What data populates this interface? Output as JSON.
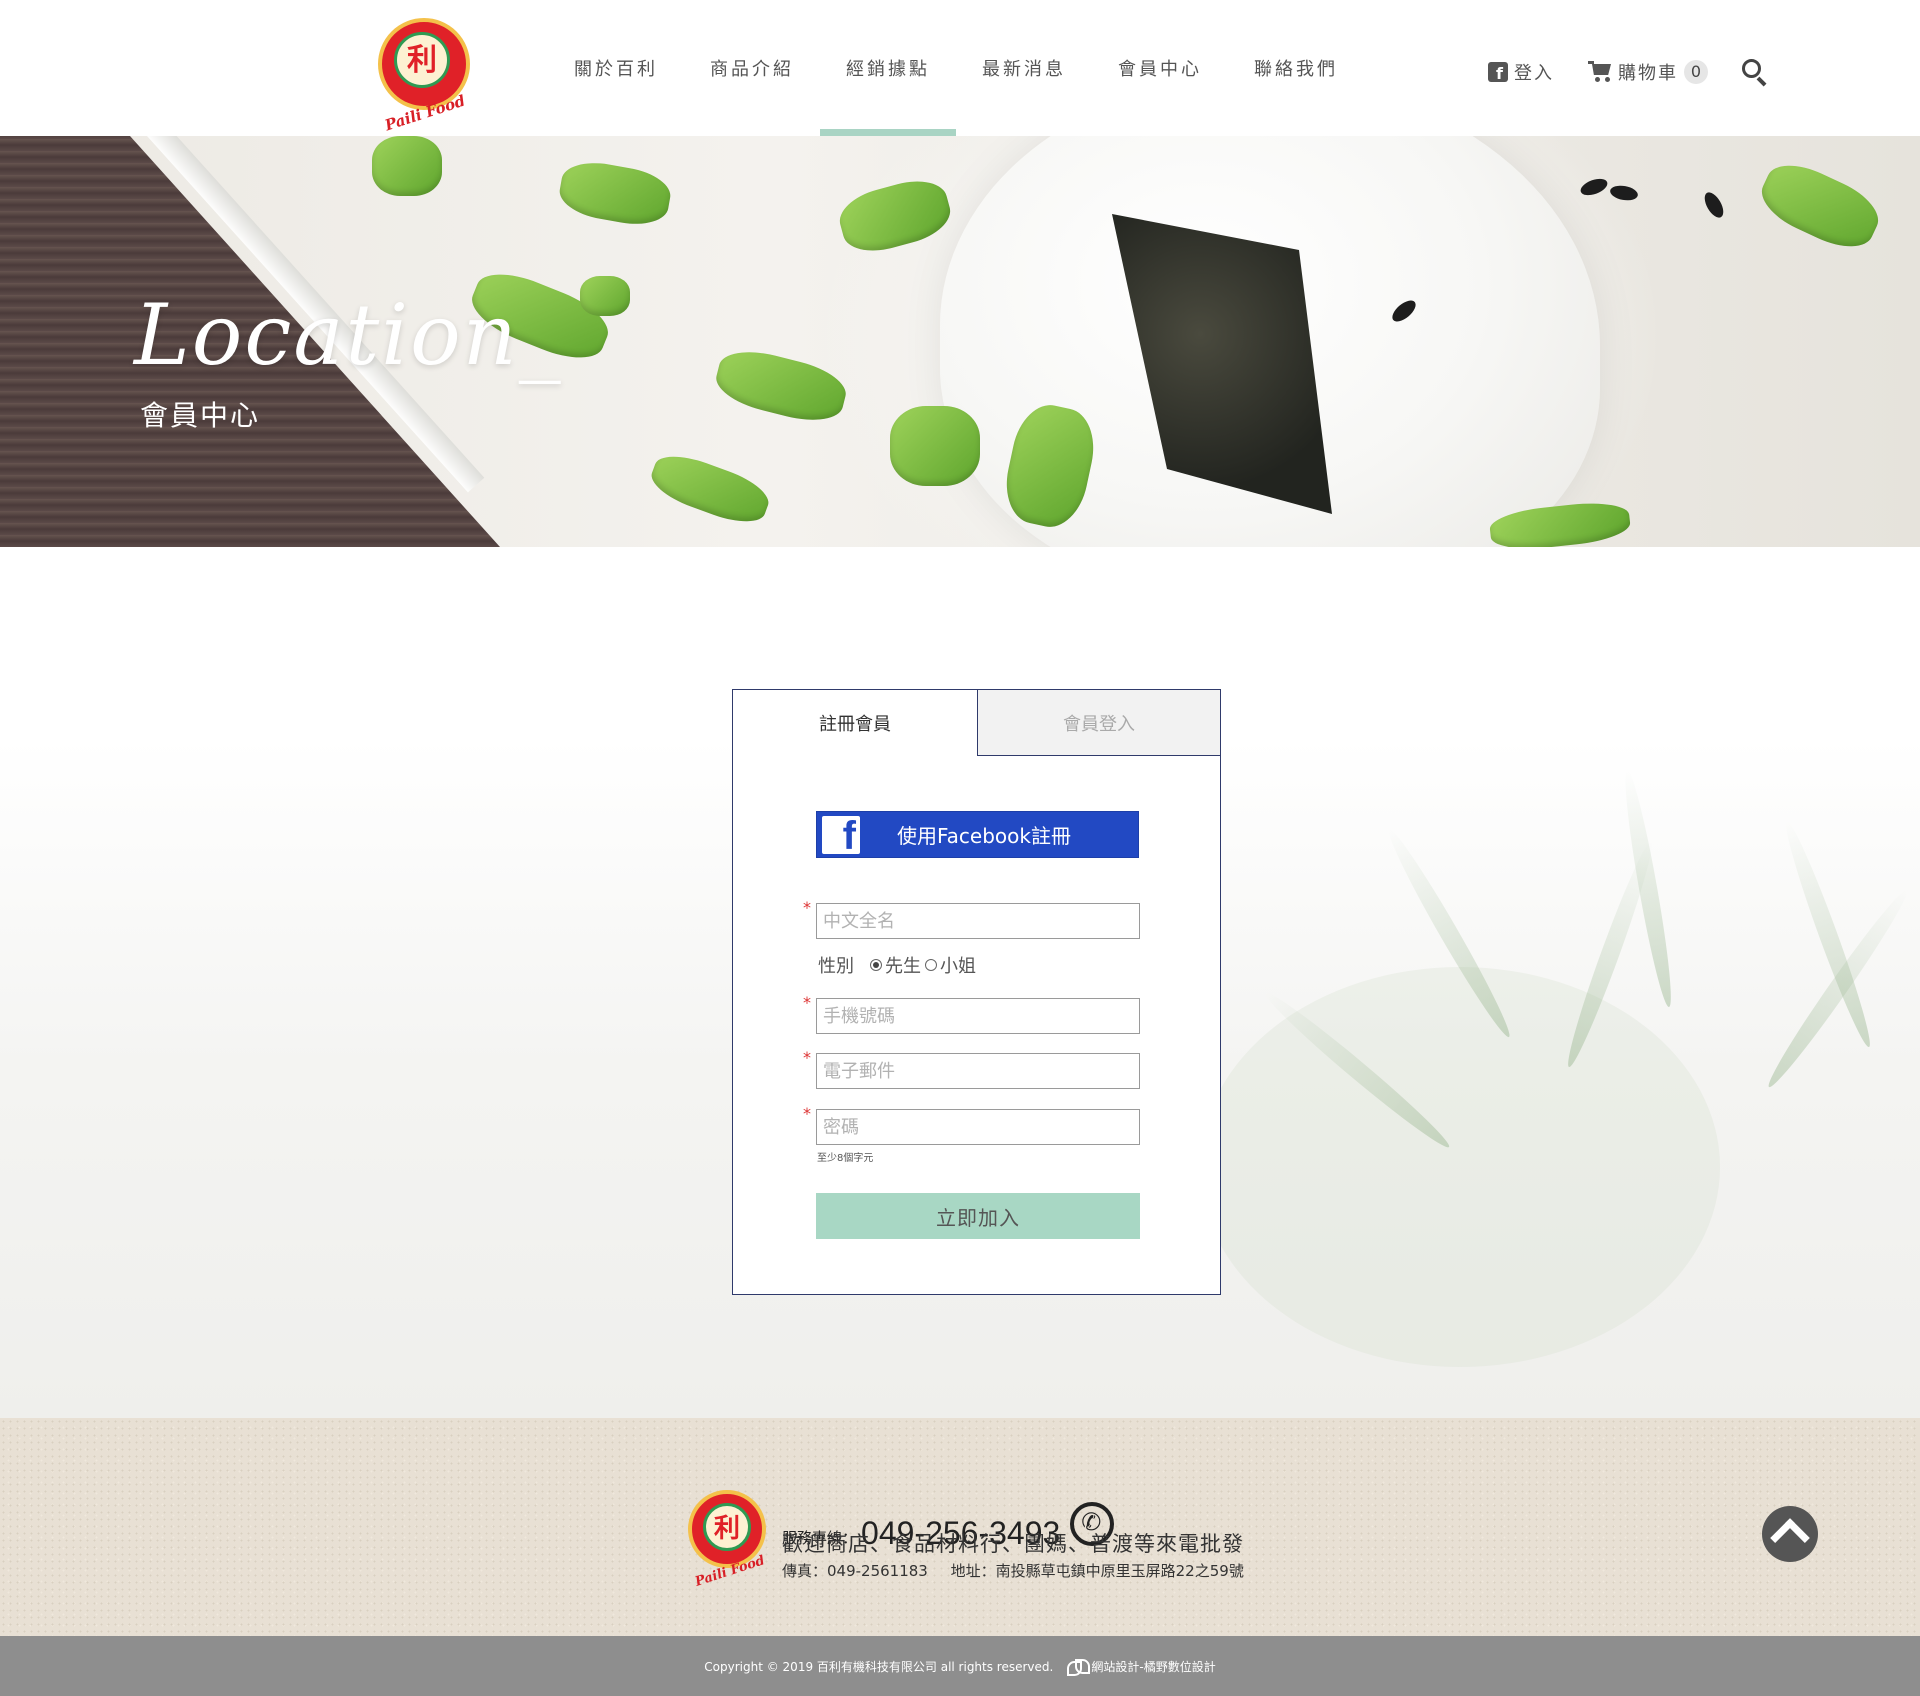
{
  "header": {
    "logo_text": "Paili Food",
    "logo_glyph": "利",
    "nav": [
      {
        "label": "關於百利"
      },
      {
        "label": "商品介紹"
      },
      {
        "label": "經銷據點",
        "active": true
      },
      {
        "label": "最新消息"
      },
      {
        "label": "會員中心"
      },
      {
        "label": "聯絡我們"
      }
    ],
    "login_label": "登入",
    "cart_label": "購物車",
    "cart_count": "0"
  },
  "banner": {
    "title": "Location_",
    "subtitle": "會員中心"
  },
  "form": {
    "tabs": [
      {
        "label": "註冊會員",
        "active": true
      },
      {
        "label": "會員登入",
        "active": false
      }
    ],
    "facebook_button": "使用Facebook註冊",
    "required_mark": "*",
    "name_placeholder": "中文全名",
    "gender_label": "性別",
    "gender_options": [
      {
        "label": "先生",
        "selected": true
      },
      {
        "label": "小姐",
        "selected": false
      }
    ],
    "phone_placeholder": "手機號碼",
    "email_placeholder": "電子郵件",
    "password_placeholder": "密碼",
    "password_hint": "至少8個字元",
    "submit_label": "立即加入"
  },
  "footer": {
    "logo_text": "Paili Food",
    "logo_glyph": "利",
    "phone_label": "服務專線：",
    "phone": "049-256-3493",
    "slogan": "歡迎商店、食品材料行、團媽、普渡等來電批發",
    "fax": "傳真：049-2561183",
    "address": "地址：南投縣草屯鎮中原里玉屏路22之59號",
    "copyright": "Copyright © 2019 百利有機科技有限公司 all rights reserved.",
    "designer": "網站設計-橘野數位設計"
  },
  "colors": {
    "accent": "#a9d4c4",
    "facebook": "#2249c3",
    "required": "#dd3333",
    "card_border": "#2f3a6b"
  },
  "icons": [
    "facebook-icon",
    "cart-icon",
    "search-icon",
    "phone-icon",
    "back-to-top-icon",
    "designer-leaf-icon"
  ]
}
